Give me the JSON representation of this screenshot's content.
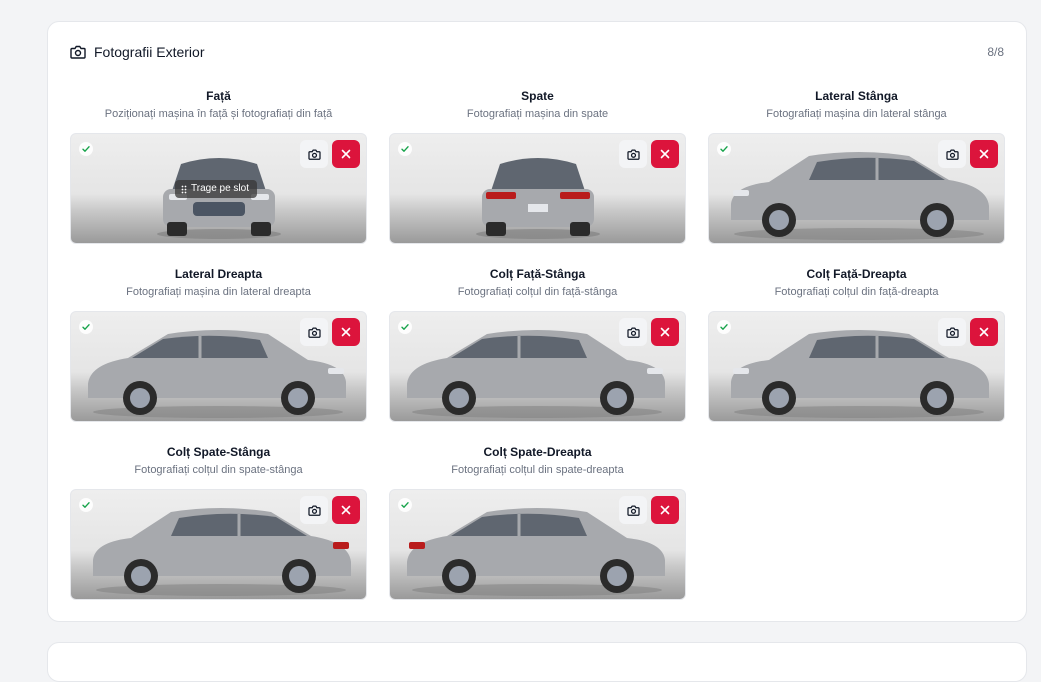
{
  "section": {
    "title": "Fotografii Exterior",
    "counter": "8/8"
  },
  "drag_hint": "Trage pe slot",
  "colors": {
    "accent_delete": "#dc143c",
    "check_green": "#16a34a"
  },
  "slots": [
    {
      "title": "Față",
      "desc": "Poziționați mașina în față și fotografiați din față",
      "view": "front",
      "status": "uploaded"
    },
    {
      "title": "Spate",
      "desc": "Fotografiați mașina din spate",
      "view": "rear",
      "status": "uploaded"
    },
    {
      "title": "Lateral Stânga",
      "desc": "Fotografiați mașina din lateral stânga",
      "view": "side-left",
      "status": "uploaded"
    },
    {
      "title": "Lateral Dreapta",
      "desc": "Fotografiați mașina din lateral dreapta",
      "view": "side-right",
      "status": "uploaded"
    },
    {
      "title": "Colț Față-Stânga",
      "desc": "Fotografiați colțul din față-stânga",
      "view": "front-left",
      "status": "uploaded"
    },
    {
      "title": "Colț Față-Dreapta",
      "desc": "Fotografiați colțul din față-dreapta",
      "view": "front-right",
      "status": "uploaded"
    },
    {
      "title": "Colț Spate-Stânga",
      "desc": "Fotografiați colțul din spate-stânga",
      "view": "rear-left",
      "status": "uploaded"
    },
    {
      "title": "Colț Spate-Dreapta",
      "desc": "Fotografiați colțul din spate-dreapta",
      "view": "rear-right",
      "status": "uploaded"
    }
  ],
  "icons": {
    "header": "camera-icon",
    "retake": "camera-icon",
    "delete": "close-icon",
    "status": "check-icon",
    "drag": "drag-handle-icon"
  }
}
